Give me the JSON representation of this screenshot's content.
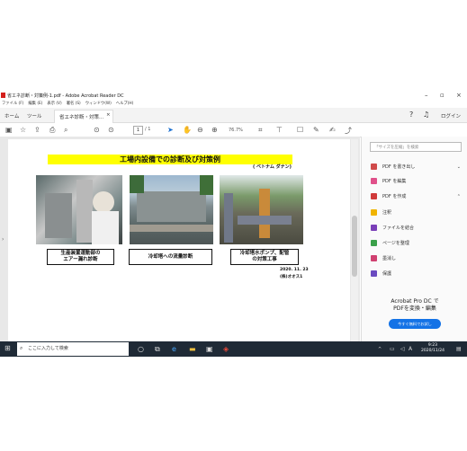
{
  "window": {
    "title": "省エネ診断・対策例-1.pdf - Adobe Acrobat Reader DC"
  },
  "menu": [
    "ファイル (F)",
    "編集 (E)",
    "表示 (V)",
    "署名 (S)",
    "ウィンドウ(W)",
    "ヘルプ(H)"
  ],
  "tabs": {
    "home": "ホーム",
    "tools": "ツール",
    "doc": "省エネ診断・対策..."
  },
  "topright": {
    "login": "ログイン"
  },
  "toolbar": {
    "page": "1",
    "total": "/ 1",
    "zoom": "76.7%"
  },
  "doc": {
    "header": "工場内設備での診断及び対策例",
    "location": "( ベトナム ダナン)",
    "captions": [
      "生産装置運動部の\nエアー漏れ診断",
      "冷却塔への流量診断",
      "冷却塔水ポンプ、配管\nの対策工事"
    ],
    "date": "2020. 11. 23",
    "company": "(株)オオス1"
  },
  "pane": {
    "search_placeholder": "「サイズを圧縮」を検索",
    "items": [
      "PDF を書き出し",
      "PDF を編集",
      "PDF を作成",
      "注釈",
      "ファイルを結合",
      "ページを整理",
      "墨消し",
      "保護"
    ],
    "promo_line1": "Acrobat Pro DC で",
    "promo_line2": "PDFを変換・編集",
    "trial_button": "今すぐ無料でお試し"
  },
  "taskbar": {
    "search": "ここに入力して検索",
    "time": "9:23",
    "date": "2020/11/24",
    "ime": "A"
  }
}
